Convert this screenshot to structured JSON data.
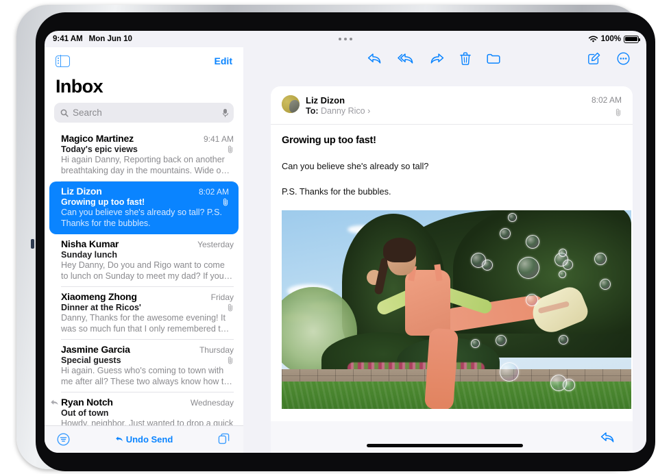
{
  "status_bar": {
    "time": "9:41 AM",
    "date": "Mon Jun 10",
    "battery_percent": "100%",
    "wifi_icon": "wifi-icon",
    "battery_icon": "battery-full-icon",
    "multitask_icon": "multitasking-dots-icon"
  },
  "sidebar": {
    "panel_toggle_icon": "sidebar-toggle-icon",
    "edit_label": "Edit",
    "title": "Inbox",
    "search": {
      "placeholder": "Search",
      "value": "",
      "search_icon": "search-icon",
      "mic_icon": "microphone-icon"
    },
    "messages": [
      {
        "sender": "Magico Martinez",
        "time": "9:41 AM",
        "subject": "Today's epic views",
        "preview": "Hi again Danny, Reporting back on another breathtaking day in the mountains. Wide o…",
        "has_attachment": true,
        "selected": false,
        "replied": false
      },
      {
        "sender": "Liz Dizon",
        "time": "8:02 AM",
        "subject": "Growing up too fast!",
        "preview": "Can you believe she's already so tall? P.S. Thanks for the bubbles.",
        "has_attachment": true,
        "selected": true,
        "replied": false
      },
      {
        "sender": "Nisha Kumar",
        "time": "Yesterday",
        "subject": "Sunday lunch",
        "preview": "Hey Danny, Do you and Rigo want to come to lunch on Sunday to meet my dad? If you…",
        "has_attachment": false,
        "selected": false,
        "replied": false
      },
      {
        "sender": "Xiaomeng Zhong",
        "time": "Friday",
        "subject": "Dinner at the Ricos'",
        "preview": "Danny, Thanks for the awesome evening! It was so much fun that I only remembered t…",
        "has_attachment": true,
        "selected": false,
        "replied": false
      },
      {
        "sender": "Jasmine Garcia",
        "time": "Thursday",
        "subject": "Special guests",
        "preview": "Hi again. Guess who's coming to town with me after all? These two always know how t…",
        "has_attachment": true,
        "selected": false,
        "replied": false
      },
      {
        "sender": "Ryan Notch",
        "time": "Wednesday",
        "subject": "Out of town",
        "preview": "Howdy, neighbor, Just wanted to drop a quick note to let you know we're leaving T…",
        "has_attachment": false,
        "selected": false,
        "replied": true
      }
    ],
    "bottom_bar": {
      "filter_icon": "filter-icon",
      "undo_send_label": "Undo Send",
      "undo_icon": "undo-arrow-icon",
      "compose_group_icon": "copy-windows-icon"
    }
  },
  "detail": {
    "toolbar": {
      "reply_icon": "reply-icon",
      "reply_all_icon": "reply-all-icon",
      "forward_icon": "forward-icon",
      "trash_icon": "trash-icon",
      "folder_icon": "folder-icon",
      "compose_icon": "compose-icon",
      "more_icon": "more-circle-icon"
    },
    "message": {
      "from": "Liz Dizon",
      "to_label": "To:",
      "to_recipient": "Danny Rico",
      "disclosure_icon": "chevron-right-icon",
      "time": "8:02 AM",
      "attachment_icon": "paperclip-icon",
      "avatar_icon": "avatar",
      "subject": "Growing up too fast!",
      "paragraphs": [
        "Can you believe she's already so tall?",
        "P.S. Thanks for the bubbles."
      ],
      "photo_alt": "Girl in peach overalls kicking in a sunny backyard with floating bubbles"
    },
    "footer": {
      "reply_icon": "reply-icon"
    }
  },
  "colors": {
    "accent": "#0a84ff",
    "selected_row": "#0a84ff",
    "sidebar_bg": "#ffffff",
    "detail_bg": "#f2f2f7"
  }
}
